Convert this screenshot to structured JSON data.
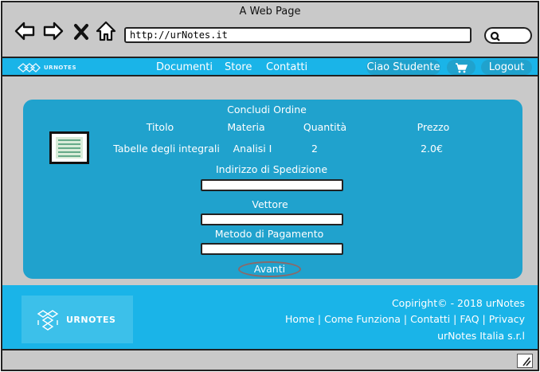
{
  "window": {
    "title": "A Web Page"
  },
  "browser": {
    "url": "http://urNotes.it",
    "icons": [
      "back-arrow-icon",
      "forward-arrow-icon",
      "close-x-icon",
      "home-icon",
      "search-icon"
    ]
  },
  "navbar": {
    "logo_text": "URNOTES",
    "links": [
      "Documenti",
      "Store",
      "Contatti"
    ],
    "greeting": "Ciao Studente",
    "cart_icon": "cart-icon",
    "logout": "Logout"
  },
  "order": {
    "title": "Concludi Ordine",
    "headers": {
      "title": "Titolo",
      "subject": "Materia",
      "quantity": "Quantità",
      "price": "Prezzo"
    },
    "item": {
      "title": "Tabelle degli integrali",
      "subject": "Analisi I",
      "quantity": "2",
      "price": "2.0€"
    },
    "shipping_label": "Indirizzo di Spedizione",
    "carrier_label": "Vettore",
    "payment_label": "Metodo di Pagamento",
    "shipping_value": "",
    "carrier_value": "",
    "payment_value": "",
    "next_button": "Avanti"
  },
  "footer": {
    "logo_text": "URNOTES",
    "copyright": "Copiright© - 2018 urNotes",
    "links": "Home | Come Funziona | Contatti | FAQ | Privacy",
    "company": "urNotes Italia s.r.l"
  },
  "colors": {
    "accent": "#1ab4e8",
    "panel": "#20a2cd",
    "chrome": "#c9c9c9"
  }
}
